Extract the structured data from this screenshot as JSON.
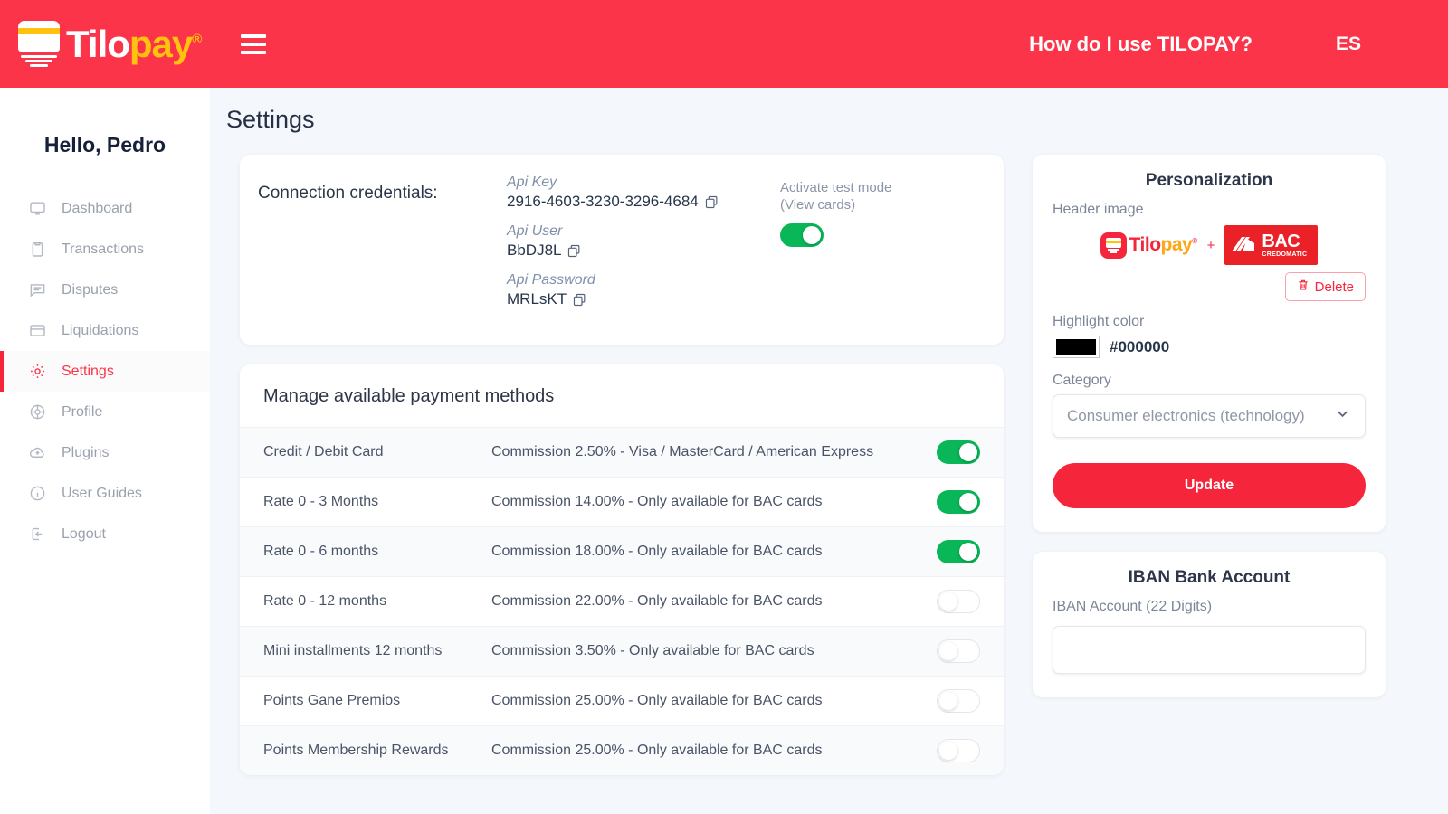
{
  "header": {
    "brand_name_part1": "Tilo",
    "brand_name_part2": "pay",
    "brand_registered": "®",
    "menu_icon": "hamburger-menu-icon",
    "help_link": "How do I use TILOPAY?",
    "language": "ES",
    "bar_color": "#fb3449"
  },
  "sidebar": {
    "greeting": "Hello, Pedro",
    "items": [
      {
        "label": "Dashboard",
        "icon": "monitor-icon",
        "active": false
      },
      {
        "label": "Transactions",
        "icon": "clipboard-icon",
        "active": false
      },
      {
        "label": "Disputes",
        "icon": "comment-icon",
        "active": false
      },
      {
        "label": "Liquidations",
        "icon": "card-icon",
        "active": false
      },
      {
        "label": "Settings",
        "icon": "gear-icon",
        "active": true
      },
      {
        "label": "Profile",
        "icon": "globe-icon",
        "active": false
      },
      {
        "label": "Plugins",
        "icon": "cloud-upload-icon",
        "active": false
      },
      {
        "label": "User Guides",
        "icon": "info-icon",
        "active": false
      },
      {
        "label": "Logout",
        "icon": "logout-icon",
        "active": false
      }
    ],
    "active_color": "#fb3449"
  },
  "page": {
    "title": "Settings",
    "background": "#f4f7fb"
  },
  "credentials": {
    "title": "Connection credentials:",
    "api_key_label": "Api Key",
    "api_key_value": "2916-4603-3230-3296-4684",
    "api_user_label": "Api User",
    "api_user_value": "BbDJ8L",
    "api_password_label": "Api Password",
    "api_password_value": "MRLsKT",
    "copy_icon": "copy-icon",
    "test_mode_label": "Activate test mode",
    "test_mode_sublabel": "(View cards)",
    "test_mode_on": true,
    "toggle_on_color": "#09b658"
  },
  "payment_methods": {
    "title": "Manage available payment methods",
    "rows": [
      {
        "name": "Credit / Debit Card",
        "description": "Commission 2.50% - Visa / MasterCard / American Express",
        "enabled": true
      },
      {
        "name": "Rate 0 - 3 Months",
        "description": "Commission 14.00% - Only available for BAC cards",
        "enabled": true
      },
      {
        "name": "Rate 0 - 6 months",
        "description": "Commission 18.00% - Only available for BAC cards",
        "enabled": true
      },
      {
        "name": "Rate 0 - 12 months",
        "description": "Commission 22.00% - Only available for BAC cards",
        "enabled": false
      },
      {
        "name": "Mini installments 12 months",
        "description": "Commission 3.50% - Only available for BAC cards",
        "enabled": false
      },
      {
        "name": "Points Gane Premios",
        "description": "Commission 25.00% - Only available for BAC cards",
        "enabled": false
      },
      {
        "name": "Points Membership Rewards",
        "description": "Commission 25.00% - Only available for BAC cards",
        "enabled": false
      }
    ]
  },
  "personalization": {
    "title": "Personalization",
    "header_image_label": "Header image",
    "header_image_tilopay": "Tilopay",
    "header_image_plus": "+",
    "header_image_bac_main": "BAC",
    "header_image_bac_sub": "CREDOMATIC",
    "delete_label": "Delete",
    "delete_icon": "trash-icon",
    "highlight_color_label": "Highlight color",
    "highlight_color_value": "#000000",
    "category_label": "Category",
    "category_value": "Consumer electronics (technology)",
    "category_chevron": "chevron-down-icon",
    "update_label": "Update",
    "accent_color": "#f5253c"
  },
  "iban": {
    "title": "IBAN Bank Account",
    "account_label": "IBAN Account (22 Digits)",
    "account_value": "",
    "account_placeholder": ""
  }
}
